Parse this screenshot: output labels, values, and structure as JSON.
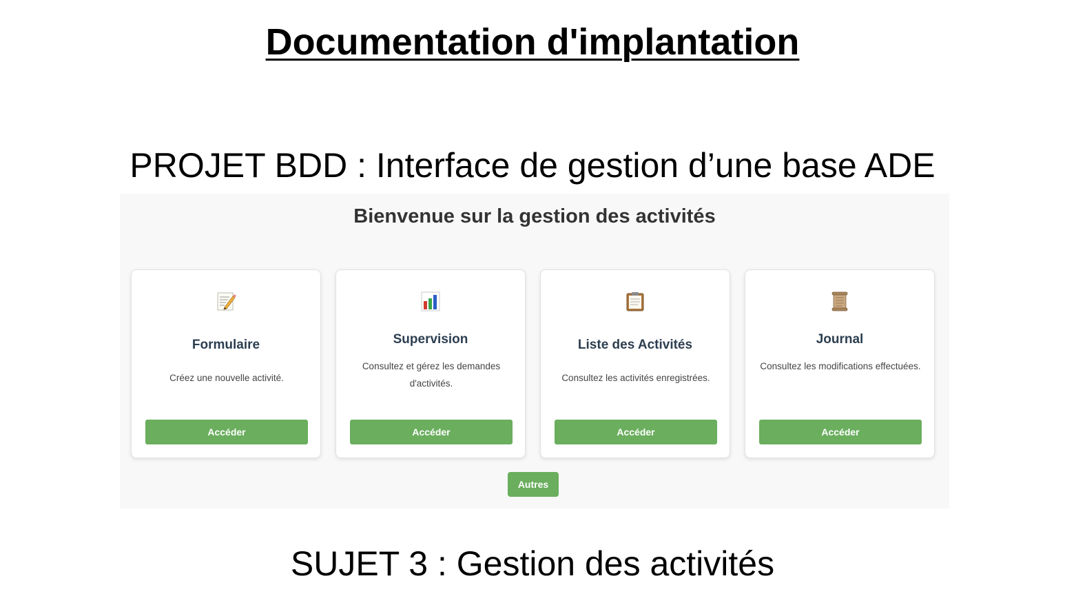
{
  "document": {
    "title": "Documentation d'implantation",
    "project_title": "PROJET BDD : Interface de gestion d’une base ADE",
    "subject_title": "SUJET 3 : Gestion des activités"
  },
  "app": {
    "heading": "Bienvenue sur la gestion des activités",
    "accent_color": "#6aae5e",
    "cards": [
      {
        "icon": "memo-pencil-icon",
        "title": "Formulaire",
        "description": "Créez une nouvelle activité.",
        "button_label": "Accéder"
      },
      {
        "icon": "bar-chart-icon",
        "title": "Supervision",
        "description": "Consultez et gérez les demandes d'activités.",
        "button_label": "Accéder"
      },
      {
        "icon": "clipboard-icon",
        "title": "Liste des Activités",
        "description": "Consultez les activités enregistrées.",
        "button_label": "Accéder"
      },
      {
        "icon": "scroll-icon",
        "title": "Journal",
        "description": "Consultez les modifications effectuées.",
        "button_label": "Accéder"
      }
    ],
    "other_button_label": "Autres"
  }
}
